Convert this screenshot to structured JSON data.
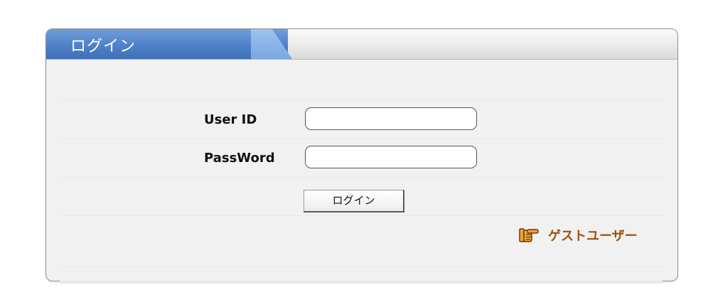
{
  "panel": {
    "title": "ログイン"
  },
  "form": {
    "user_id_label": "User ID",
    "user_id_value": "",
    "password_label": "PassWord",
    "password_value": "",
    "login_button_label": "ログイン"
  },
  "guest": {
    "label": "ゲストユーザー",
    "icon": "pointing-hand-icon"
  },
  "colors": {
    "header_blue": "#4d7fc6",
    "guest_link": "#a24f07",
    "panel_bg": "#f1f1f1"
  }
}
